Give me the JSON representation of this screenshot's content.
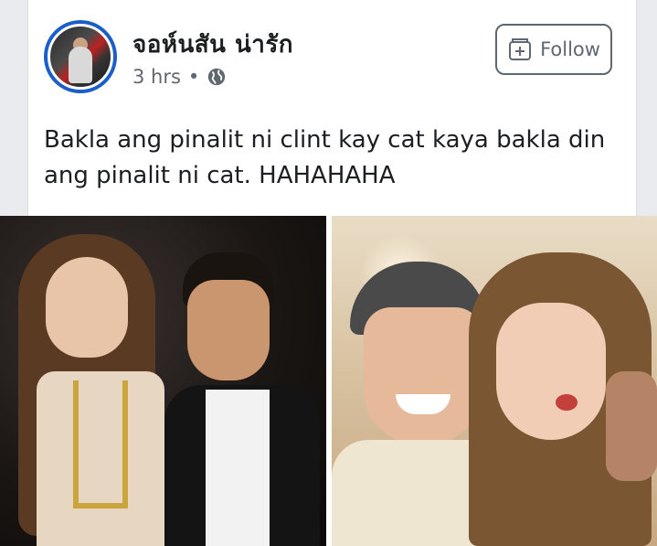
{
  "post": {
    "author": "จอห์นสัน น่ารัก",
    "time": "3 hrs",
    "separator": "•",
    "privacy_icon": "globe-icon",
    "follow_label": "Follow",
    "follow_icon": "follow-add-icon",
    "text": "Bakla ang pinalit ni clint kay cat kaya bakla din ang pinalit ni cat. HAHAHAHA"
  },
  "colors": {
    "avatar_ring": "#1a5ec7",
    "text": "#1c1e21",
    "meta": "#606770"
  },
  "photos": [
    {
      "name": "left-photo"
    },
    {
      "name": "right-photo"
    }
  ]
}
